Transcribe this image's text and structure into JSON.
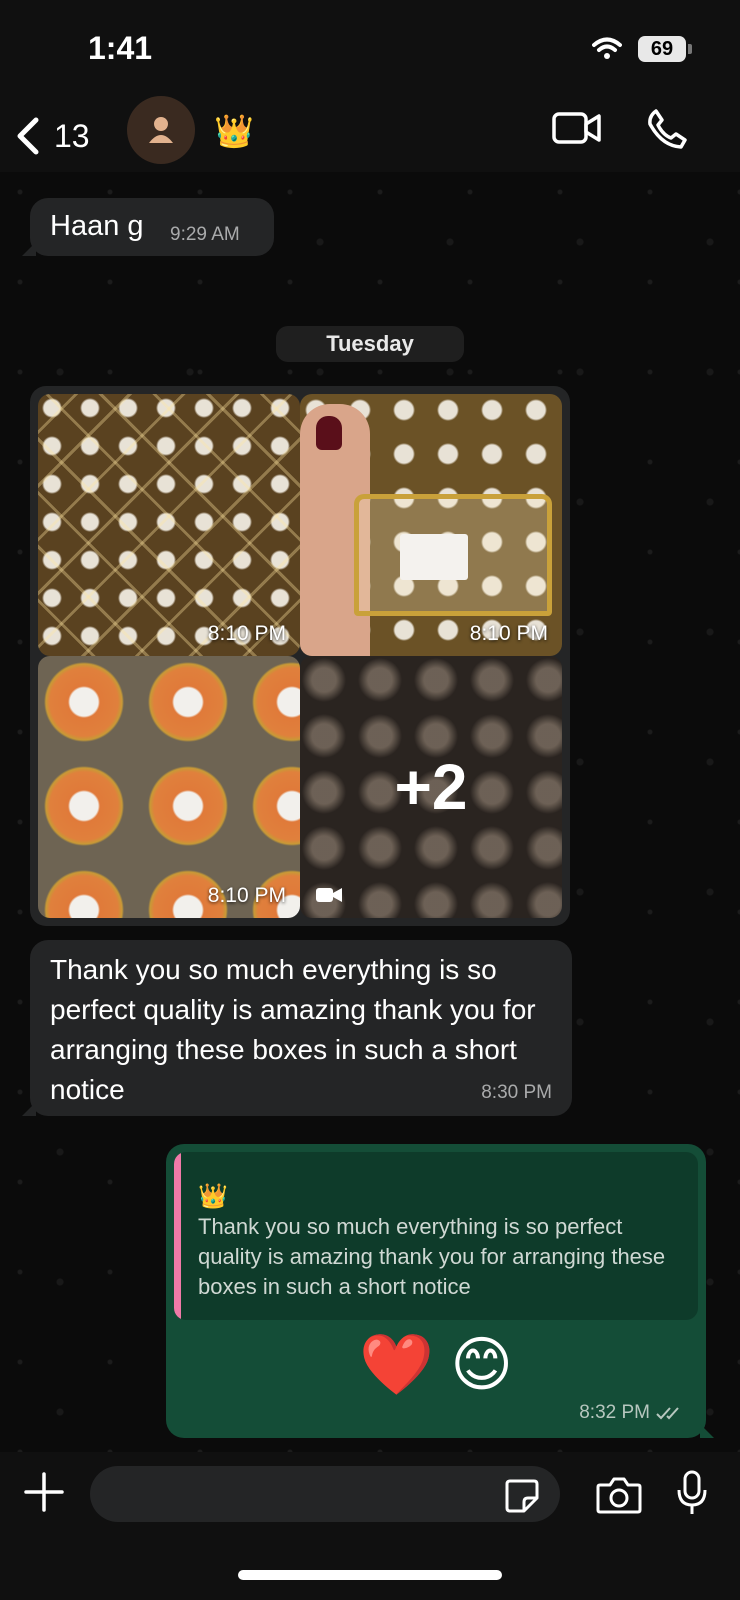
{
  "status_bar": {
    "time": "1:41",
    "battery": "69"
  },
  "header": {
    "back_count": "13",
    "contact_name": "👑"
  },
  "messages": [
    {
      "text": "Haan g",
      "time": "9:29 AM"
    },
    {
      "day": "Tuesday"
    },
    {
      "album": [
        {
          "time": "8:10 PM"
        },
        {
          "time": "8:10 PM"
        },
        {
          "time": "8:10 PM"
        },
        {
          "more": "+2"
        }
      ]
    },
    {
      "text": "Thank you so much everything is so perfect quality is amazing thank you for arranging these boxes in such a short notice",
      "time": "8:30 PM"
    },
    {
      "quote_name": "👑",
      "quote_text": "Thank you so much everything is so perfect quality is amazing thank you for arranging these boxes in such a short notice",
      "emojis": "❤️ 😊",
      "time": "8:32 PM"
    }
  ],
  "composer": {
    "placeholder": ""
  },
  "colors": {
    "incoming": "#242526",
    "outgoing": "#144d37",
    "quote_bar": "#f07aa8"
  }
}
